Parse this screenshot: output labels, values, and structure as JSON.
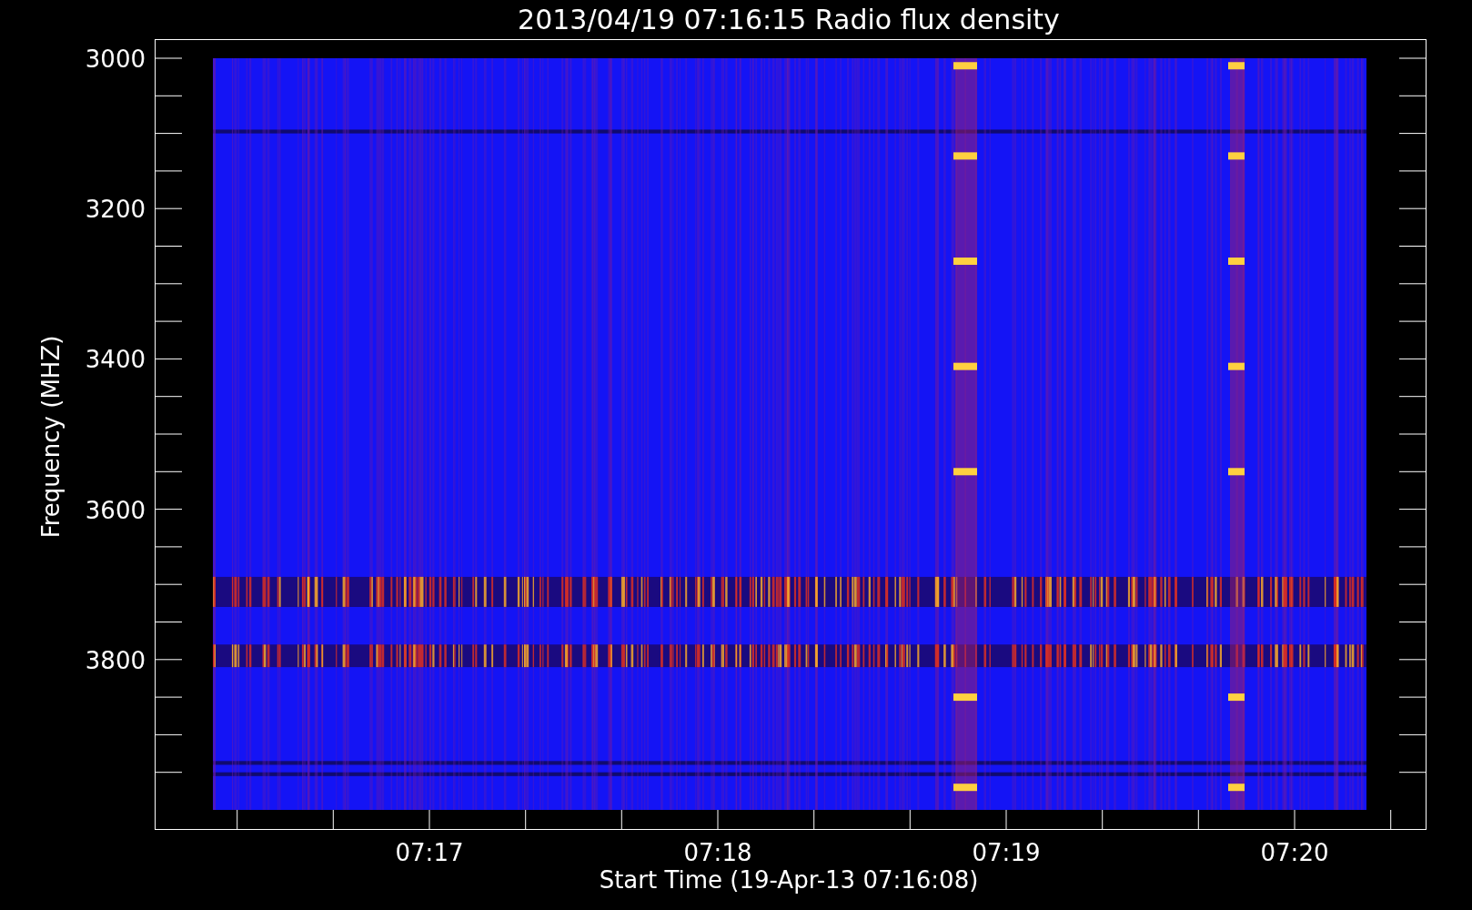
{
  "title": "2013/04/19 07:16:15 Radio flux density",
  "xlabel": "Start Time (19-Apr-13 07:16:08)",
  "ylabel": "Frequency (MHZ)",
  "yticks": [
    "3000",
    "3200",
    "3400",
    "3600",
    "3800"
  ],
  "xticks": [
    "07:17",
    "07:18",
    "07:19",
    "07:20"
  ]
}
